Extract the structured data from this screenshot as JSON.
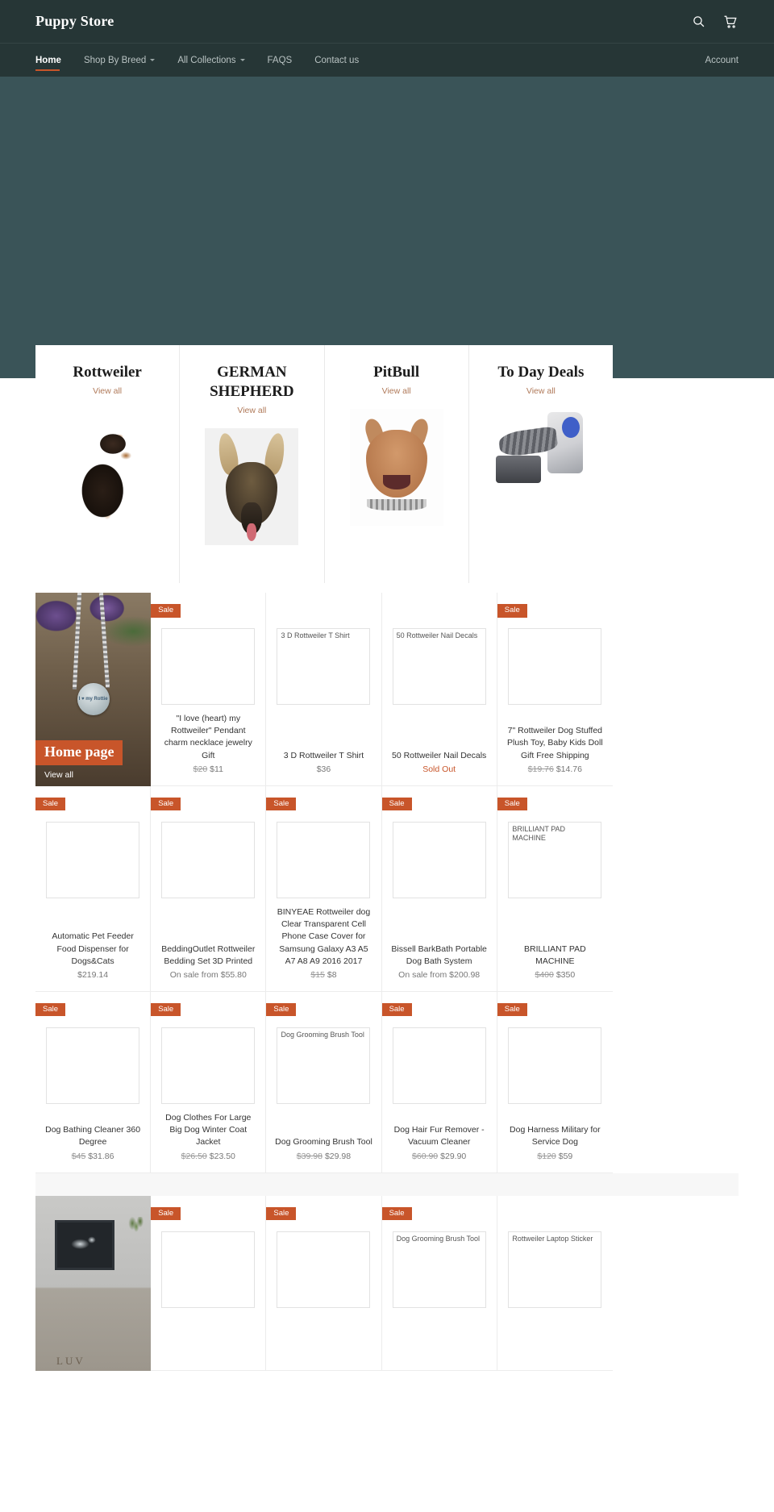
{
  "header": {
    "brand": "Puppy Store",
    "search_icon": "search-icon",
    "cart_icon": "cart-icon"
  },
  "nav": {
    "items": [
      {
        "label": "Home",
        "active": true,
        "has_caret": false
      },
      {
        "label": "Shop By Breed",
        "active": false,
        "has_caret": true
      },
      {
        "label": "All Collections",
        "active": false,
        "has_caret": true
      },
      {
        "label": "FAQS",
        "active": false,
        "has_caret": false
      },
      {
        "label": "Contact us",
        "active": false,
        "has_caret": false
      }
    ],
    "account": "Account"
  },
  "collections": [
    {
      "title": "Rottweiler",
      "view_all": "View all",
      "art": "rottweiler"
    },
    {
      "title": "GERMAN SHEPHERD",
      "view_all": "View all",
      "art": "german-shepherd"
    },
    {
      "title": "PitBull",
      "view_all": "View all",
      "art": "pitbull"
    },
    {
      "title": "To Day Deals",
      "view_all": "View all",
      "art": "vacuum"
    }
  ],
  "feature_cards": {
    "home_page": {
      "title": "Home page",
      "view_all": "View all",
      "pendant_text": "I ♥ my Rottie"
    }
  },
  "labels": {
    "sale": "Sale",
    "sold_out": "Sold Out"
  },
  "rows": [
    {
      "products": [
        {
          "feature": true,
          "kind": "necklace"
        },
        {
          "sale": true,
          "alt": "",
          "title": "\"I love (heart) my Rottweiler\" Pendant charm necklace jewelry Gift",
          "price_old": "$20",
          "price": "$11"
        },
        {
          "sale": false,
          "alt": "3 D Rottweiler T Shirt",
          "title": "3 D Rottweiler T Shirt",
          "price_old": "",
          "price": "$36"
        },
        {
          "sale": false,
          "alt": "50 Rottweiler Nail Decals",
          "title": "50 Rottweiler Nail Decals",
          "price_old": "",
          "price": "Sold Out",
          "sold_out": true
        },
        {
          "sale": true,
          "alt": "",
          "title": "7\" Rottweiler Dog Stuffed Plush Toy, Baby Kids Doll Gift Free Shipping",
          "price_old": "$19.76",
          "price": "$14.76"
        }
      ]
    },
    {
      "products": [
        {
          "sale": true,
          "alt": "",
          "title": "Automatic Pet Feeder Food Dispenser for Dogs&Cats",
          "price_old": "",
          "price": "$219.14"
        },
        {
          "sale": true,
          "alt": "",
          "title": "BeddingOutlet Rottweiler Bedding Set 3D Printed",
          "price_old": "",
          "price": "On sale from $55.80"
        },
        {
          "sale": true,
          "alt": "",
          "title": "BINYEAE Rottweiler dog Clear Transparent Cell Phone Case Cover for Samsung Galaxy A3 A5 A7 A8 A9 2016 2017",
          "price_old": "$15",
          "price": "$8"
        },
        {
          "sale": true,
          "alt": "",
          "title": "Bissell BarkBath Portable Dog Bath System",
          "price_old": "",
          "price": "On sale from $200.98"
        },
        {
          "sale": true,
          "alt": "BRILLIANT PAD MACHINE",
          "title": "BRILLIANT PAD MACHINE",
          "price_old": "$400",
          "price": "$350"
        }
      ]
    },
    {
      "products": [
        {
          "sale": true,
          "alt": "",
          "title": "Dog Bathing Cleaner 360 Degree",
          "price_old": "$45",
          "price": "$31.86"
        },
        {
          "sale": true,
          "alt": "",
          "title": "Dog Clothes For Large Big Dog Winter Coat Jacket",
          "price_old": "$26.50",
          "price": "$23.50"
        },
        {
          "sale": true,
          "alt": "Dog Grooming Brush Tool",
          "title": "Dog Grooming Brush Tool",
          "price_old": "$39.98",
          "price": "$29.98"
        },
        {
          "sale": true,
          "alt": "",
          "title": "Dog Hair Fur Remover - Vacuum Cleaner",
          "price_old": "$60.90",
          "price": "$29.90"
        },
        {
          "sale": true,
          "alt": "",
          "title": "Dog Harness Military for Service Dog",
          "price_old": "$120",
          "price": "$59"
        }
      ]
    },
    {
      "products": [
        {
          "feature": true,
          "kind": "wall",
          "letters": "LUV"
        },
        {
          "sale": true,
          "alt": "",
          "title": "",
          "price_old": "",
          "price": ""
        },
        {
          "sale": true,
          "alt": "",
          "title": "",
          "price_old": "",
          "price": ""
        },
        {
          "sale": true,
          "alt": "Dog Grooming Brush Tool",
          "title": "",
          "price_old": "",
          "price": ""
        },
        {
          "sale": false,
          "alt": "Rottweiler Laptop Sticker",
          "title": "",
          "price_old": "",
          "price": ""
        }
      ]
    }
  ],
  "colors": {
    "header_bg": "#263636",
    "hero_bg": "#3a5458",
    "accent": "#c8552a",
    "link": "#b07a5a",
    "page_bg": "#f7f7f7"
  }
}
